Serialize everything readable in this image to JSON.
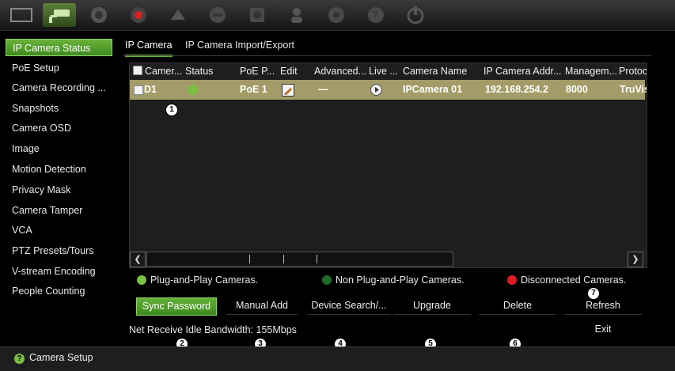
{
  "toolbar": {
    "icons": [
      "display-icon",
      "camera-icon",
      "network-icon",
      "record-icon",
      "alarm-icon",
      "device-icon",
      "storage-icon",
      "user-icon",
      "system-icon",
      "help-icon",
      "power-icon"
    ]
  },
  "sidebar": {
    "items": [
      {
        "label": "IP Camera Status",
        "selected": true
      },
      {
        "label": "PoE Setup"
      },
      {
        "label": "Camera Recording ..."
      },
      {
        "label": "Snapshots"
      },
      {
        "label": "Camera OSD"
      },
      {
        "label": "Image"
      },
      {
        "label": "Motion Detection"
      },
      {
        "label": "Privacy Mask"
      },
      {
        "label": "Camera Tamper"
      },
      {
        "label": "VCA"
      },
      {
        "label": "PTZ Presets/Tours"
      },
      {
        "label": "V-stream Encoding"
      },
      {
        "label": "People Counting"
      }
    ]
  },
  "tabs": [
    {
      "label": "IP Camera",
      "active": true
    },
    {
      "label": "IP Camera Import/Export"
    }
  ],
  "table": {
    "headers": [
      "Camer...",
      "Status",
      "PoE P...",
      "Edit",
      "Advanced...",
      "Live ...",
      "Camera Name",
      "IP Camera Addr...",
      "Managem...",
      "Protoc"
    ],
    "rows": [
      {
        "camera": "D1",
        "status_color": "#7bc043",
        "poe_port": "PoE 1",
        "advanced": "—",
        "camera_name": "IPCamera 01",
        "ip_address": "192.168.254.2",
        "management_port": "8000",
        "protocol": "TruVis"
      }
    ]
  },
  "legend": {
    "plug_and_play": "Plug-and-Play Cameras.",
    "non_plug_and_play": "Non Plug-and-Play Cameras.",
    "disconnected": "Disconnected Cameras.",
    "colors": {
      "plug_and_play": "#7bc043",
      "non_plug_and_play": "#1f6b2a",
      "disconnected": "#e01b24"
    }
  },
  "buttons": {
    "sync_password": "Sync Password",
    "manual_add": "Manual Add",
    "device_search": "Device Search/...",
    "upgrade": "Upgrade",
    "delete": "Delete",
    "refresh": "Refresh",
    "exit": "Exit"
  },
  "bandwidth_text": "Net Receive Idle Bandwidth: 155Mbps",
  "callouts": [
    "1",
    "2",
    "3",
    "4",
    "5",
    "6",
    "7"
  ],
  "status_bar": {
    "label": "Camera Setup"
  },
  "colors": {
    "accent": "#69b23a",
    "selected_row": "#a39c68"
  }
}
